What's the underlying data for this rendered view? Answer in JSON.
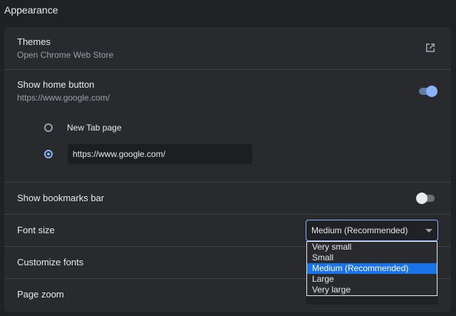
{
  "section": {
    "title": "Appearance"
  },
  "themes": {
    "label": "Themes",
    "sublabel": "Open Chrome Web Store"
  },
  "home_button": {
    "label": "Show home button",
    "sublabel": "https://www.google.com/",
    "enabled": true,
    "options": [
      {
        "label": "New Tab page",
        "checked": false
      },
      {
        "url_value": "https://www.google.com/",
        "checked": true
      }
    ]
  },
  "bookmarks_bar": {
    "label": "Show bookmarks bar",
    "enabled": false
  },
  "font_size": {
    "label": "Font size",
    "selected": "Medium (Recommended)",
    "options": [
      "Very small",
      "Small",
      "Medium (Recommended)",
      "Large",
      "Very large"
    ]
  },
  "customize_fonts": {
    "label": "Customize fonts"
  },
  "page_zoom": {
    "label": "Page zoom"
  },
  "colors": {
    "accent": "#8ab4f8",
    "background": "#202124",
    "card": "#292a2d",
    "highlight": "#1a73e8"
  }
}
